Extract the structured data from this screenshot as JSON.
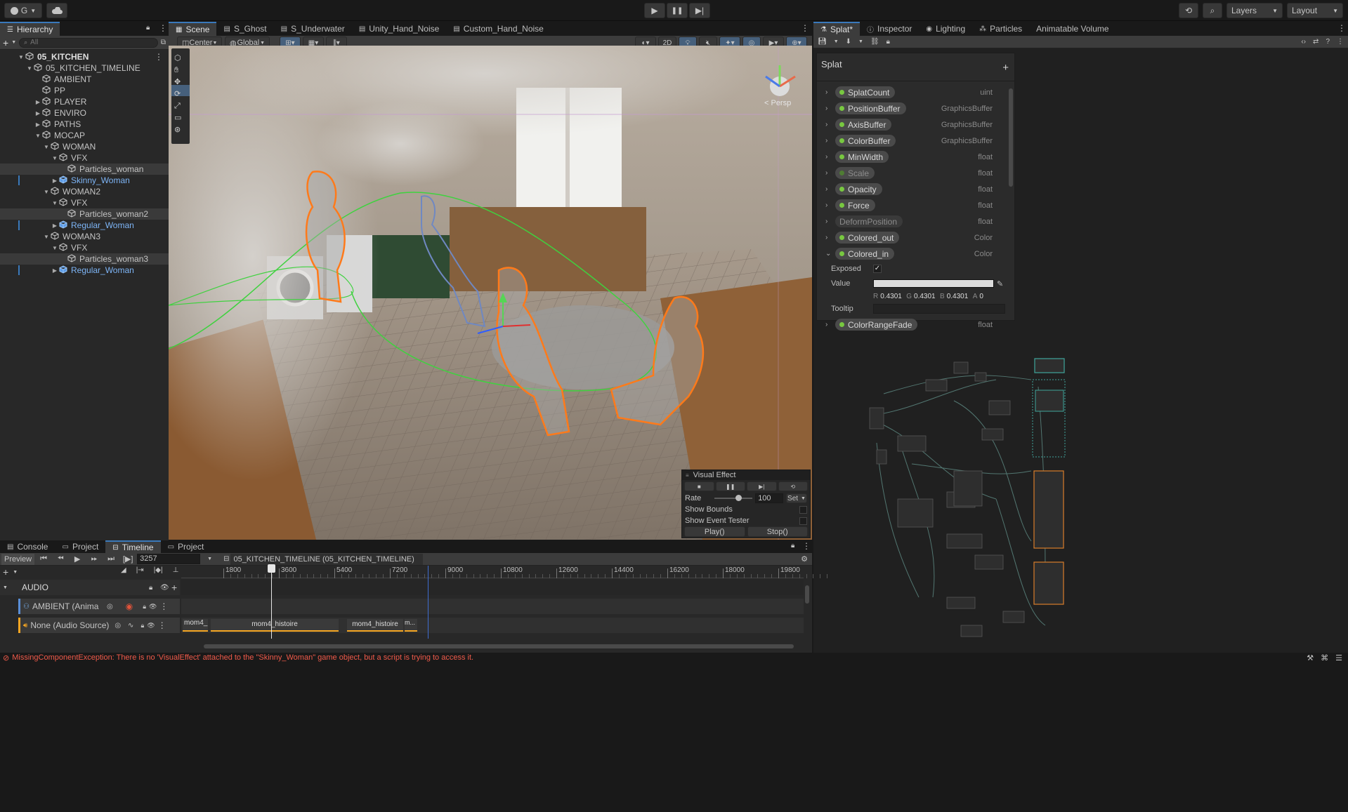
{
  "toolbar": {
    "account_label": "G",
    "layers_label": "Layers",
    "layout_label": "Layout"
  },
  "hierarchy": {
    "tab_label": "Hierarchy",
    "search_placeholder": "All",
    "items": [
      {
        "label": "05_KITCHEN",
        "depth": 0,
        "bold": true
      },
      {
        "label": "05_KITCHEN_TIMELINE",
        "depth": 1
      },
      {
        "label": "AMBIENT",
        "depth": 2
      },
      {
        "label": "PP",
        "depth": 2
      },
      {
        "label": "PLAYER",
        "depth": 2
      },
      {
        "label": "ENVIRO",
        "depth": 2
      },
      {
        "label": "PATHS",
        "depth": 2
      },
      {
        "label": "MOCAP",
        "depth": 2
      },
      {
        "label": "WOMAN",
        "depth": 3
      },
      {
        "label": "VFX",
        "depth": 4
      },
      {
        "label": "Particles_woman",
        "depth": 5
      },
      {
        "label": "Skinny_Woman",
        "depth": 4
      },
      {
        "label": "WOMAN2",
        "depth": 3
      },
      {
        "label": "VFX",
        "depth": 4
      },
      {
        "label": "Particles_woman2",
        "depth": 5
      },
      {
        "label": "Regular_Woman",
        "depth": 4
      },
      {
        "label": "WOMAN3",
        "depth": 3
      },
      {
        "label": "VFX",
        "depth": 4
      },
      {
        "label": "Particles_woman3",
        "depth": 5
      },
      {
        "label": "Regular_Woman",
        "depth": 4
      }
    ]
  },
  "scene": {
    "tabs": [
      "Scene",
      "S_Ghost",
      "S_Underwater",
      "Unity_Hand_Noise",
      "Custom_Hand_Noise"
    ],
    "pivot_label": "Center",
    "space_label": "Global",
    "mode_2d": "2D",
    "persp_label": "< Persp",
    "visual_effect": {
      "title": "Visual Effect",
      "rate_label": "Rate",
      "rate_value": "100",
      "set_label": "Set",
      "show_bounds": "Show Bounds",
      "show_event_tester": "Show Event Tester",
      "play_label": "Play()",
      "stop_label": "Stop()"
    }
  },
  "right_tabs": [
    "Splat*",
    "Inspector",
    "Lighting",
    "Particles",
    "Animatable Volume"
  ],
  "blackboard": {
    "title": "Splat",
    "add_label": "+",
    "properties": [
      {
        "name": "SplatCount",
        "type": "uint"
      },
      {
        "name": "PositionBuffer",
        "type": "GraphicsBuffer"
      },
      {
        "name": "AxisBuffer",
        "type": "GraphicsBuffer"
      },
      {
        "name": "ColorBuffer",
        "type": "GraphicsBuffer"
      },
      {
        "name": "MinWidth",
        "type": "float"
      },
      {
        "name": "Scale",
        "type": "float"
      },
      {
        "name": "Opacity",
        "type": "float"
      },
      {
        "name": "Force",
        "type": "float"
      },
      {
        "name": "DeformPosition",
        "type": "float"
      },
      {
        "name": "Colored_out",
        "type": "Color"
      },
      {
        "name": "Colored_in",
        "type": "Color"
      }
    ],
    "exposed_label": "Exposed",
    "value_label": "Value",
    "tooltip_label": "Tooltip",
    "color": {
      "r": "0.4301",
      "g": "0.4301",
      "b": "0.4301",
      "a": "0",
      "r_label": "R",
      "g_label": "G",
      "b_label": "B",
      "a_label": "A"
    },
    "last_property": {
      "name": "ColorRangeFade",
      "type": "float"
    }
  },
  "bottom_tabs": [
    "Console",
    "Project",
    "Timeline",
    "Project"
  ],
  "timeline": {
    "preview_label": "Preview",
    "frame_value": "3257",
    "asset_label": "05_KITCHEN_TIMELINE (05_KITCHEN_TIMELINE)",
    "ruler_ticks": [
      "1800",
      "3600",
      "5400",
      "7200",
      "9000",
      "10800",
      "12600",
      "14400",
      "16200",
      "18000",
      "19800"
    ],
    "audio_group": "AUDIO",
    "tracks": [
      {
        "label": "AMBIENT (Anima"
      },
      {
        "label": "None (Audio Source)"
      }
    ],
    "clips": [
      "mom4_...",
      "mom4_histoire",
      "mom4_histoire",
      "m..."
    ]
  },
  "status": {
    "error_message": "MissingComponentException: There is no 'VisualEffect' attached to the \"Skinny_Woman\" game object, but a script is trying to access it."
  }
}
